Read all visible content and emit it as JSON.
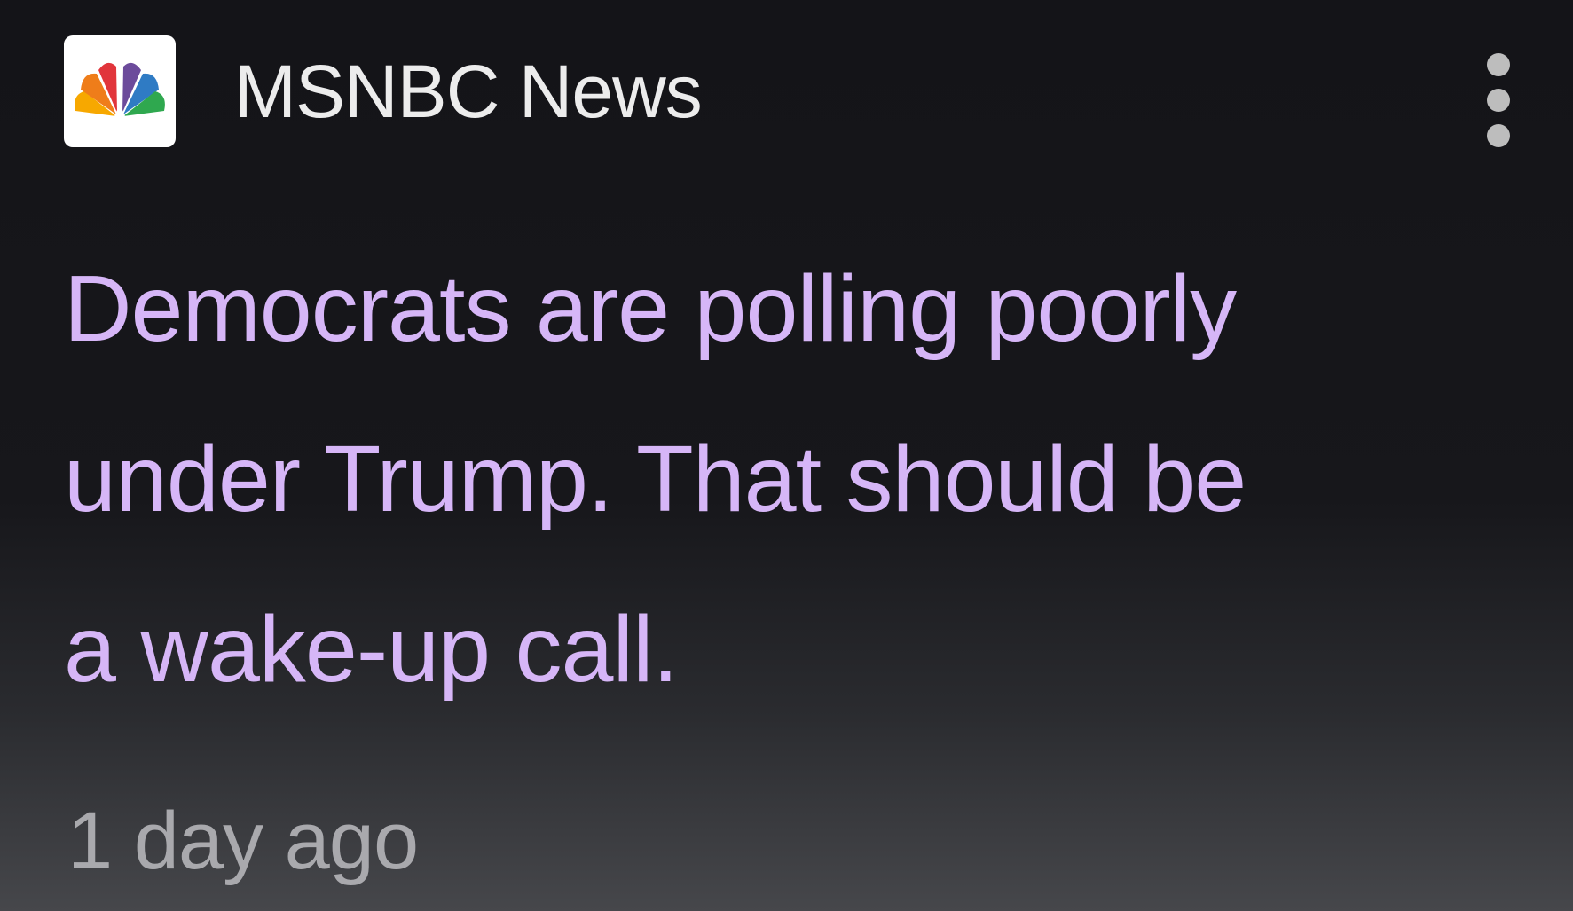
{
  "card": {
    "source": {
      "name": "MSNBC News",
      "logo_icon": "peacock-logo-icon"
    },
    "menu_icon": "more-vertical-icon",
    "headline_lines": [
      "Democrats are polling poorly",
      "under Trump. That should be",
      "a wake-up call."
    ],
    "timestamp": "1 day ago"
  },
  "colors": {
    "headline": "#d6b6f7",
    "source_name": "#ececec",
    "timestamp": "#a9a9ad",
    "background_top": "#141418",
    "background_bottom": "#46474b"
  }
}
